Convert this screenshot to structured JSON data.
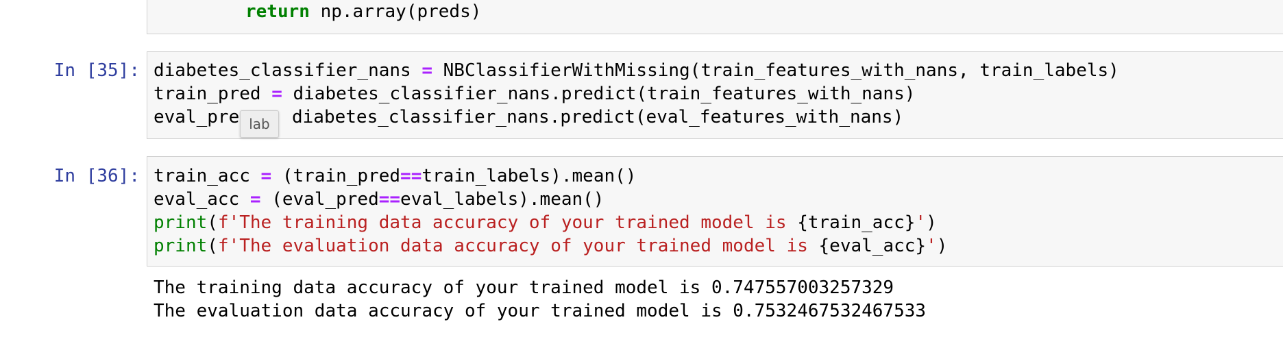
{
  "cell_prev": {
    "keyword": "return",
    "rest": " np.array(preds)"
  },
  "cell35": {
    "prompt": "In [35]:",
    "line1_a": "diabetes_classifier_nans ",
    "line1_op": "=",
    "line1_b": " NBClassifierWithMissing(train_features_with_nans, train_labels)",
    "line2_a": "train_pred ",
    "line2_op": "=",
    "line2_b": " diabetes_classifier_nans.predict(train_features_with_nans)",
    "line3_a": "eval_pre",
    "line3_b": "diabetes_classifier_nans.predict(eval_features_with_nans)",
    "tooltip": "lab"
  },
  "cell36": {
    "prompt": "In [36]:",
    "line1_a": "train_acc ",
    "line1_op1": "=",
    "line1_b": " (train_pred",
    "line1_op2": "==",
    "line1_c": "train_labels).mean()",
    "line2_a": "eval_acc ",
    "line2_op1": "=",
    "line2_b": " (eval_pred",
    "line2_op2": "==",
    "line2_c": "eval_labels).mean()",
    "line3_fn": "print",
    "line3_p": "(",
    "line3_str": "f'The training data accuracy of your trained model is ",
    "line3_var": "{train_acc}",
    "line3_end": "'",
    "line3_close": ")",
    "line4_fn": "print",
    "line4_p": "(",
    "line4_str": "f'The evaluation data accuracy of your trained model is ",
    "line4_var": "{eval_acc}",
    "line4_end": "'",
    "line4_close": ")"
  },
  "output36": {
    "line1": "The training data accuracy of your trained model is 0.747557003257329",
    "line2": "The evaluation data accuracy of your trained model is 0.7532467532467533"
  }
}
